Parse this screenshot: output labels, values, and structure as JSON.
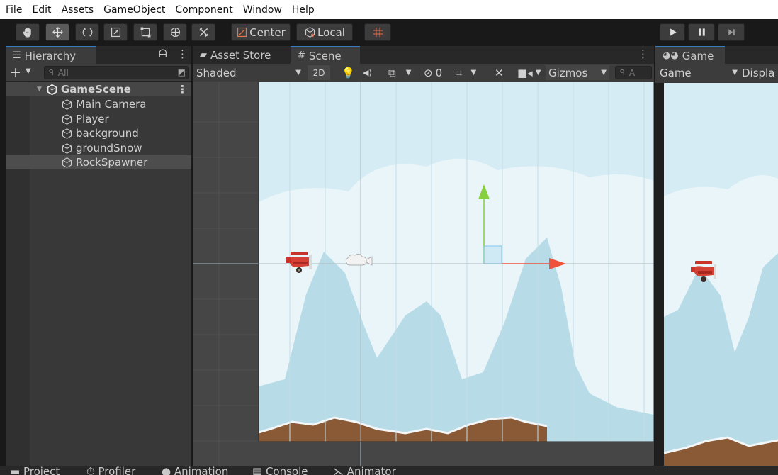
{
  "menu": [
    "File",
    "Edit",
    "Assets",
    "GameObject",
    "Component",
    "Window",
    "Help"
  ],
  "toolbar": {
    "tools": [
      "hand-icon",
      "move-icon",
      "rotate-icon",
      "scale-icon",
      "rect-icon",
      "transform-icon",
      "custom-tool-icon"
    ],
    "pivot_label": "Center",
    "space_label": "Local",
    "play_icons": [
      "play-icon",
      "pause-icon",
      "step-icon"
    ]
  },
  "hierarchy": {
    "tab_label": "Hierarchy",
    "search_placeholder": "All",
    "scene_name": "GameScene",
    "items": [
      {
        "label": "Main Camera"
      },
      {
        "label": "Player"
      },
      {
        "label": "background"
      },
      {
        "label": "groundSnow"
      },
      {
        "label": "RockSpawner"
      }
    ],
    "selected": "RockSpawner"
  },
  "scene": {
    "tabs": [
      "Asset Store",
      "Scene"
    ],
    "active_tab": "Scene",
    "shading_mode": "Shaded",
    "mode_2d": "2D",
    "hidden_count": "0",
    "gizmos_label": "Gizmos",
    "search_placeholder": "A"
  },
  "game": {
    "tab_label": "Game",
    "view_select": "Game",
    "display_label": "Displa"
  },
  "bottom_tabs": [
    "Project",
    "Profiler",
    "Animation",
    "Console",
    "Animator"
  ],
  "colors": {
    "sky": "#d5ecf4",
    "cloud": "#e9f5f9",
    "mountain": "#b8dbe8",
    "ground": "#8a5a36",
    "snow": "#f4f7f8",
    "plane": "#c8332b",
    "gizmo_x": "#f0533c",
    "gizmo_y": "#86cf3d",
    "accent": "#3a79bb"
  }
}
